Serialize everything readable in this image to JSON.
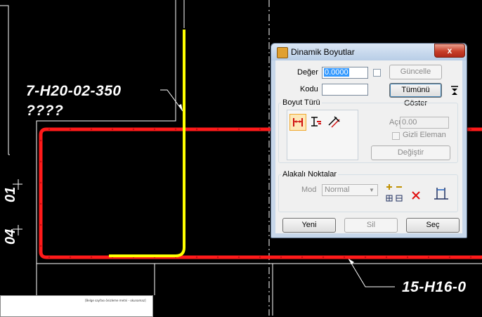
{
  "drawing": {
    "labels": {
      "top_left": "7-H20-02-350",
      "top_left_sub": "????",
      "bottom_right": "15-H16-0",
      "dim_upper": "01",
      "dim_lower": "04"
    },
    "colors": {
      "background": "#000000",
      "rebar_red": "#ff1a1a",
      "rebar_yellow": "#ffff00",
      "lines": "#ffffff"
    }
  },
  "dialog": {
    "title": "Dinamik Boyutlar",
    "close_label": "x",
    "value_label": "Değer",
    "value": "0.0000",
    "code_label": "Kodu",
    "code_value": "",
    "update_button": "Güncelle",
    "show_all_button": "Tümünü Göster",
    "dimension_type_group": "Boyut Türü",
    "angle_label": "Açı",
    "angle_value": "0.00",
    "hidden_element_label": "Gizli Eleman",
    "change_button": "Değiştir",
    "related_points_group": "Alakalı Noktalar",
    "mode_label": "Mod",
    "mode_value": "Normal",
    "new_button": "Yeni",
    "delete_button": "Sil",
    "select_button": "Seç"
  },
  "thumbnail": {
    "text": "[Belge sayfası önizleme metni - okunamaz]"
  }
}
